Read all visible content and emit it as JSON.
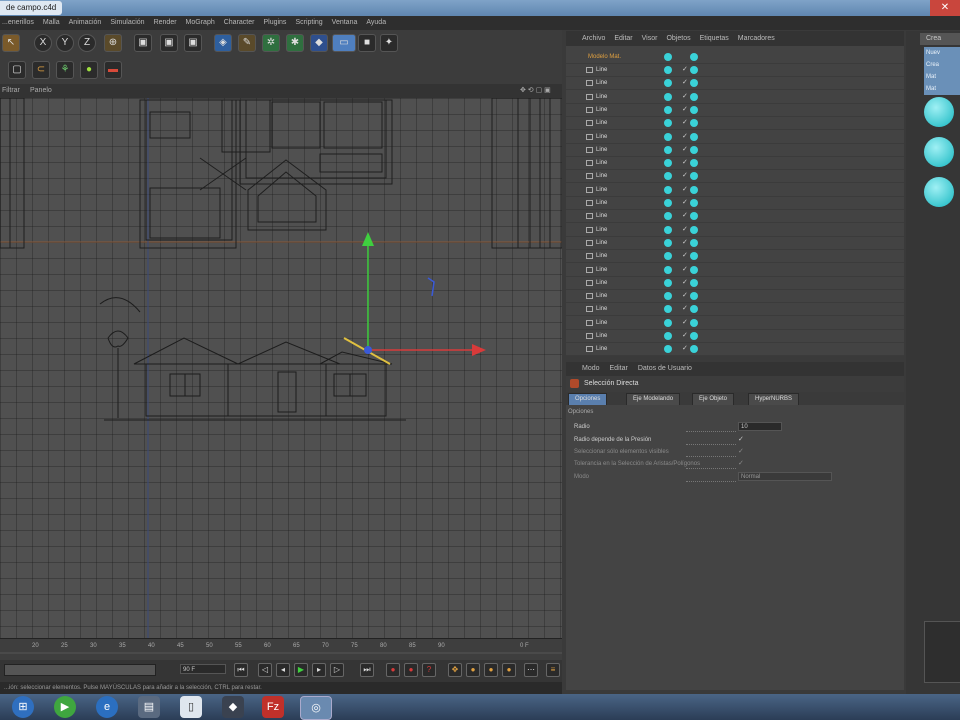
{
  "window": {
    "title_tab": "de campo.c4d",
    "close_glyph": "✕"
  },
  "menu": [
    "...enerillos",
    "Malla",
    "Animación",
    "Simulación",
    "Render",
    "MoGraph",
    "Character",
    "Plugins",
    "Scripting",
    "Ventana",
    "Ayuda"
  ],
  "toolbar": {
    "axis_labels": [
      "X",
      "Y",
      "Z"
    ]
  },
  "viewport": {
    "menu": [
      "Filtrar",
      "Panelo"
    ]
  },
  "timeline": {
    "ticks": [
      "20",
      "25",
      "30",
      "35",
      "40",
      "45",
      "50",
      "55",
      "60",
      "65",
      "70",
      "75",
      "80",
      "85",
      "90",
      "0 F"
    ],
    "frame_field": "90 F",
    "status_text": "...ión: seleccionar elementos. Pulse MAYÚSCULAS para añadir a la selección, CTRL para restar."
  },
  "object_manager": {
    "menu": [
      "Archivo",
      "Editar",
      "Visor",
      "Objetos",
      "Etiquetas",
      "Marcadores"
    ],
    "root_label": "Modelo Mat.",
    "rows": [
      "Line",
      "Line",
      "Line",
      "Line",
      "Line",
      "Line",
      "Line",
      "Line",
      "Line",
      "Line",
      "Line",
      "Line",
      "Line",
      "Line",
      "Line",
      "Line",
      "Line",
      "Line",
      "Line",
      "Line",
      "Line",
      "Line"
    ]
  },
  "attribute_manager": {
    "menu": [
      "Modo",
      "Editar",
      "Datos de Usuario"
    ],
    "title": "Selección Directa",
    "tabs": [
      "Opciones",
      "Eje Modelando",
      "Eje Objeto",
      "HyperNURBS"
    ],
    "section": "Opciones",
    "fields": [
      {
        "label": "Radio",
        "value": "10"
      },
      {
        "label": "Radio depende de la Presión",
        "value": "✓"
      },
      {
        "label": "Seleccionar sólo elementos visibles",
        "value": "✓"
      },
      {
        "label": "Tolerancia en la Selección de Aristas/Polígonos",
        "value": "✓"
      },
      {
        "label": "Modo",
        "value": "Normal"
      }
    ]
  },
  "right_panel": {
    "header": "Crea",
    "items": [
      "Nuev",
      "Crea",
      "Mat",
      "Mat"
    ]
  },
  "taskbar": {
    "icons": [
      "start-orb",
      "media-icon",
      "explorer-icon",
      "folder-icon",
      "file-icon",
      "plugin-icon",
      "filezilla-icon",
      "chrome-icon"
    ]
  },
  "colors": {
    "accent_cyan": "#3ad2d8",
    "axis_y": "#3fcf3f",
    "axis_x": "#d83a3a",
    "axis_z": "#3a5ad8",
    "selection": "#e0c040"
  }
}
